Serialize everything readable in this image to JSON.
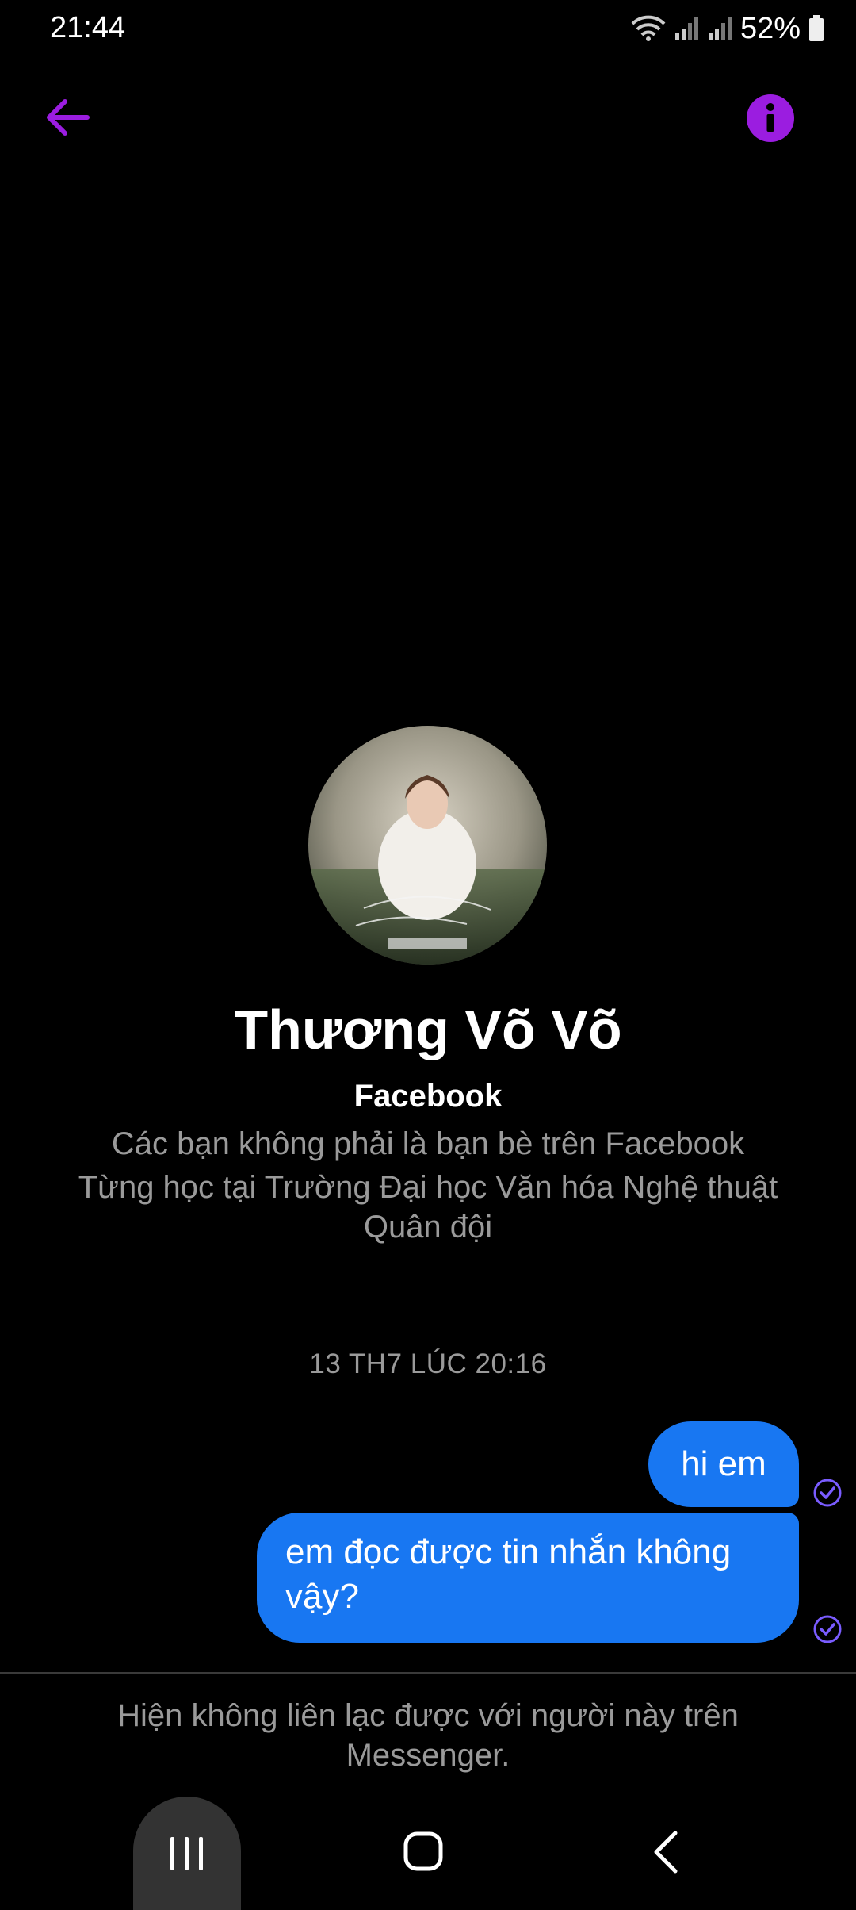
{
  "status_bar": {
    "time": "21:44",
    "battery": "52%",
    "icons": [
      "wifi-icon",
      "signal-icon",
      "signal-icon",
      "battery-icon"
    ]
  },
  "header": {
    "back_icon": "arrow-left-icon",
    "info_icon": "info-icon",
    "accent_color": "#9b1de0"
  },
  "profile": {
    "name": "Thương Võ Võ",
    "source": "Facebook",
    "friend_status": "Các bạn không phải là bạn bè trên Facebook",
    "education": "Từng học tại Trường Đại học Văn hóa Nghệ thuật Quân đội"
  },
  "conversation": {
    "timestamp": "13 TH7 LÚC 20:16",
    "messages": [
      {
        "text": "hi em",
        "status_icon": "seen-check-icon"
      },
      {
        "text": "em đọc được tin nhắn không vậy?",
        "status_icon": "seen-check-icon"
      }
    ],
    "bubble_color": "#1877f2"
  },
  "footer": {
    "unavailable_text": "Hiện không liên lạc được với người này trên Messenger."
  },
  "nav_bar": {
    "recent_icon": "recent-apps-icon",
    "home_icon": "home-icon",
    "back_icon": "back-icon"
  }
}
